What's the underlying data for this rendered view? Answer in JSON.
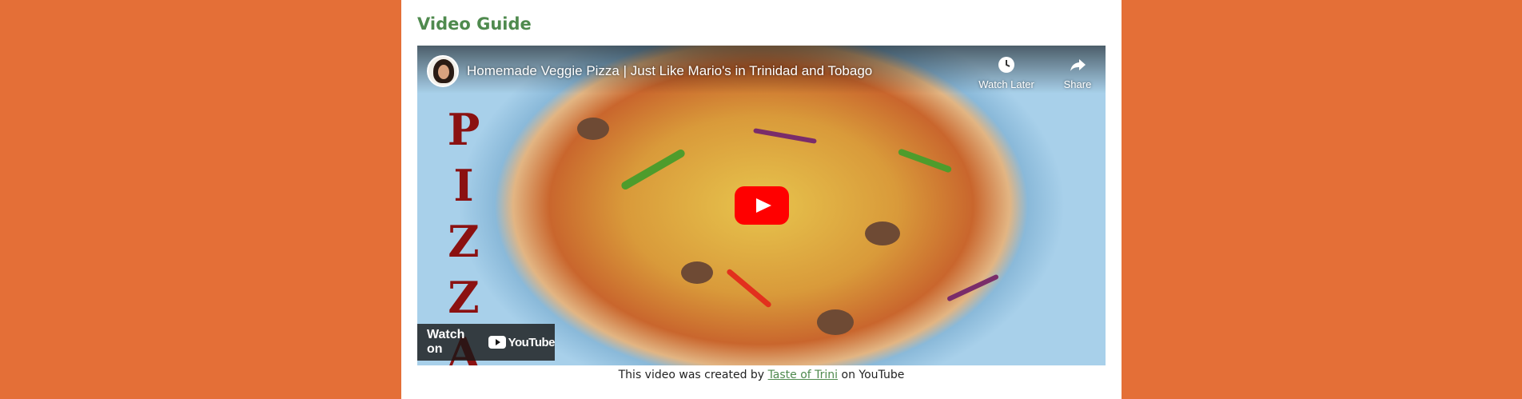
{
  "section": {
    "heading": "Video Guide"
  },
  "video": {
    "title": "Homemade Veggie Pizza | Just Like Mario's in Trinidad and Tobago",
    "watch_later_label": "Watch Later",
    "share_label": "Share",
    "watch_on_label": "Watch on",
    "youtube_logo_text": "YouTube",
    "thumbnail_side_text": "PIZZA"
  },
  "caption": {
    "prefix": "This video was created by",
    "link_text": "Taste of Trini",
    "suffix": "on YouTube"
  },
  "colors": {
    "background": "#e46f37",
    "heading": "#4f8a4e",
    "link": "#4f8a4e",
    "play_button": "#ff0000"
  },
  "icons": {
    "watch_later": "clock-icon",
    "share": "share-arrow-icon",
    "play": "play-icon",
    "youtube": "youtube-logo-icon"
  }
}
